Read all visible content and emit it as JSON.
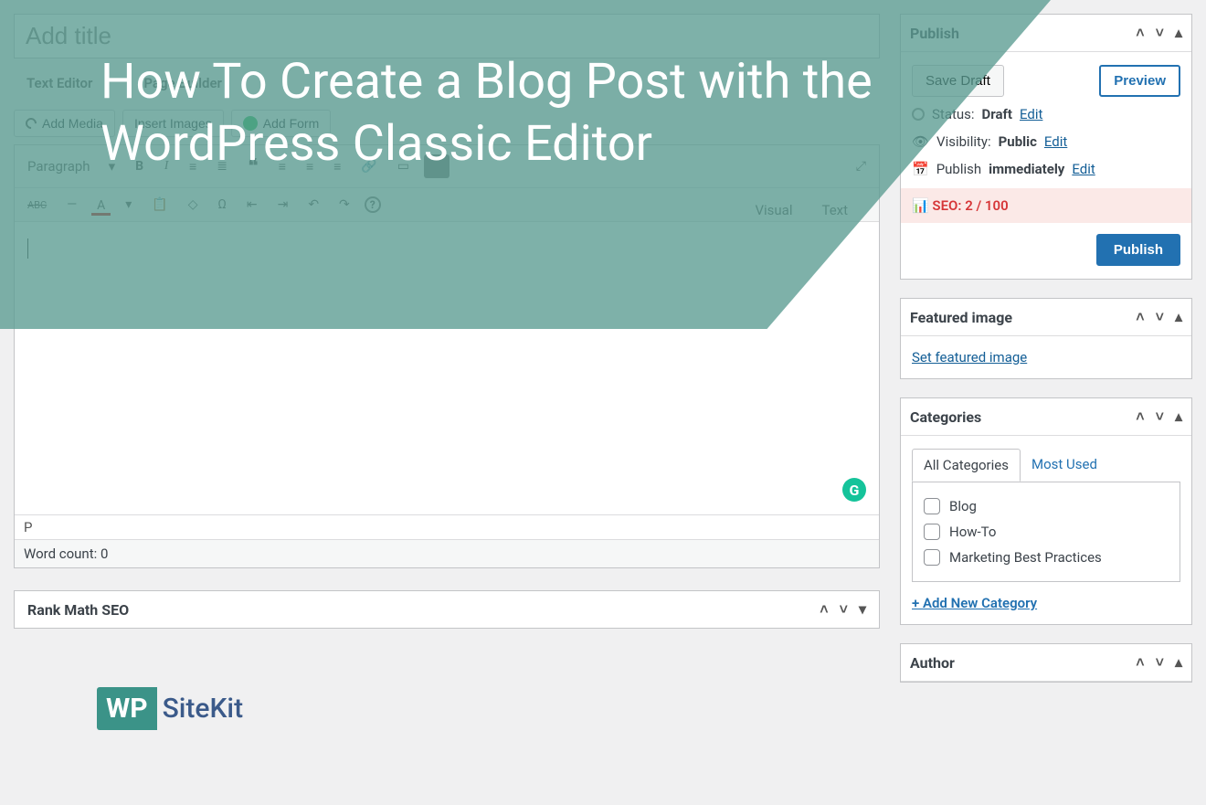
{
  "overlay": {
    "title": "How To Create a Blog Post with the WordPress Classic Editor",
    "logo_wp": "WP",
    "logo_site": "SiteKit"
  },
  "editor": {
    "title_placeholder": "Add title",
    "tabs": {
      "text": "Text Editor",
      "page": "Page Builder"
    },
    "media_buttons": {
      "add_media": "Add Media",
      "insert_images": "Insert Images",
      "add_form": "Add Form"
    },
    "mode_tabs": {
      "visual": "Visual",
      "text": "Text"
    },
    "format_select": "Paragraph",
    "path": "P",
    "word_count": "Word count: 0"
  },
  "rankmath": {
    "title": "Rank Math SEO"
  },
  "publish": {
    "panel_title": "Publish",
    "save_draft": "Save Draft",
    "preview": "Preview",
    "status_label": "Status:",
    "status_value": "Draft",
    "visibility_label": "Visibility:",
    "visibility_value": "Public",
    "publish_label": "Publish",
    "publish_value": "immediately",
    "edit": "Edit",
    "seo": "SEO: 2 / 100",
    "publish_btn": "Publish"
  },
  "featured": {
    "title": "Featured image",
    "set": "Set featured image"
  },
  "categories": {
    "title": "Categories",
    "tab_all": "All Categories",
    "tab_used": "Most Used",
    "items": [
      "Blog",
      "How-To",
      "Marketing Best Practices"
    ],
    "add_new": "+ Add New Category"
  },
  "author": {
    "title": "Author"
  }
}
